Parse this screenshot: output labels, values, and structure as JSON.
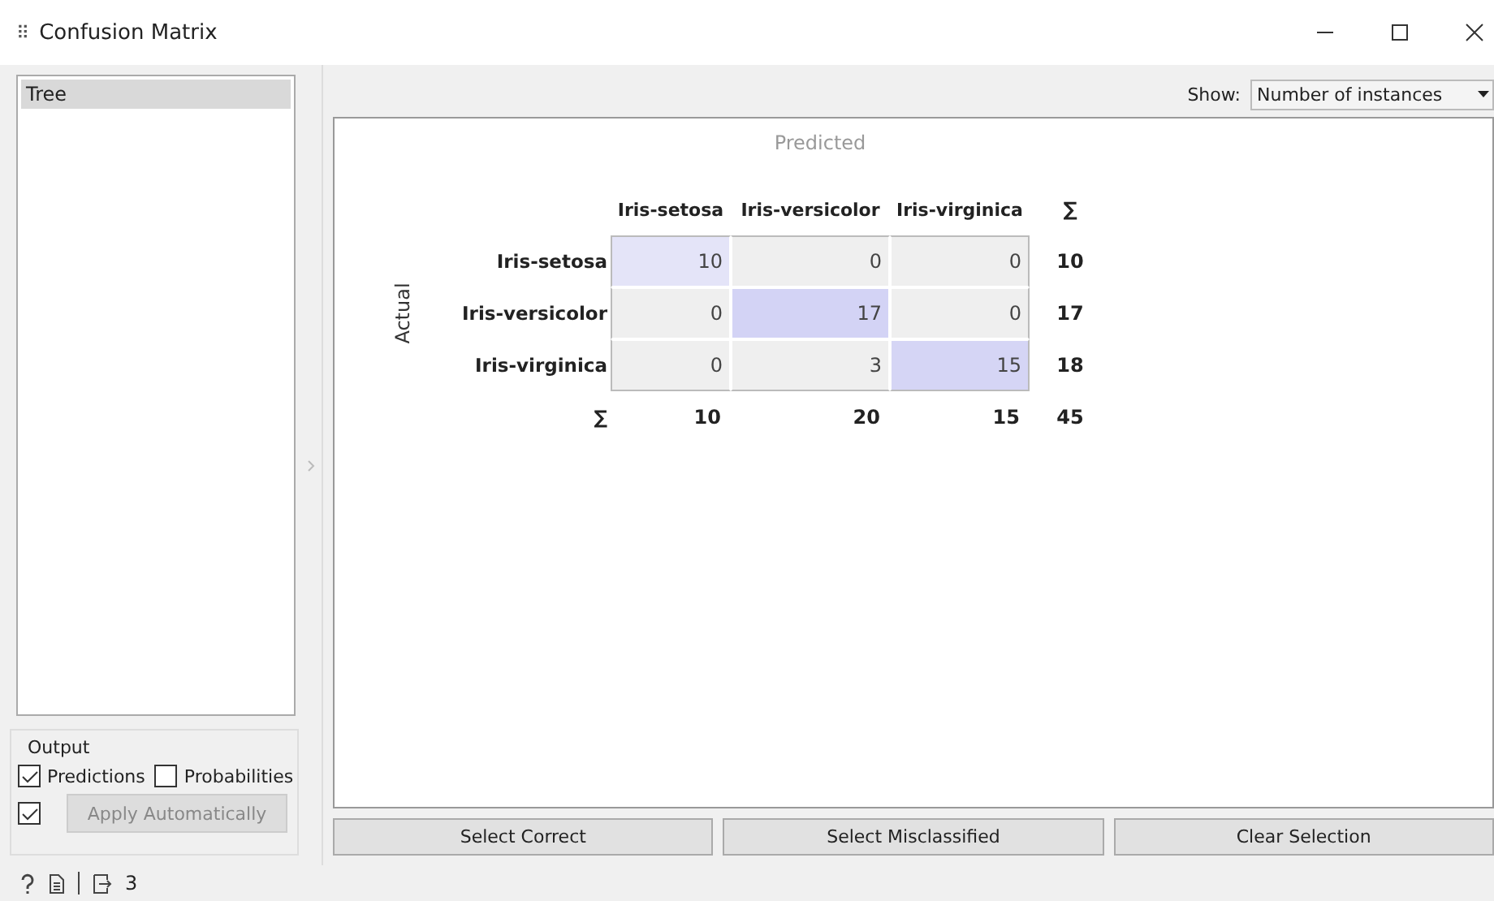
{
  "window": {
    "title": "Confusion Matrix",
    "icon": "⠿"
  },
  "learners": [
    {
      "label": "Tree",
      "selected": true
    }
  ],
  "output": {
    "title": "Output",
    "options": [
      {
        "label": "Predictions",
        "checked": true
      },
      {
        "label": "Probabilities",
        "checked": false
      }
    ],
    "auto_apply": {
      "checked": true,
      "label": "Apply Automatically",
      "disabled": true
    }
  },
  "show": {
    "label": "Show:",
    "value": "Number of instances"
  },
  "matrix": {
    "predicted_label": "Predicted",
    "actual_label": "Actual",
    "columns": [
      "Iris-setosa",
      "Iris-versicolor",
      "Iris-virginica"
    ],
    "sum_symbol": "∑",
    "rows": [
      {
        "label": "Iris-setosa",
        "cells": [
          {
            "value": "10",
            "color": "#e4e4f8"
          },
          {
            "value": "0",
            "color": "#efefef"
          },
          {
            "value": "0",
            "color": "#efefef"
          }
        ],
        "sum": "10"
      },
      {
        "label": "Iris-versicolor",
        "cells": [
          {
            "value": "0",
            "color": "#efefef"
          },
          {
            "value": "17",
            "color": "#d3d3f5"
          },
          {
            "value": "0",
            "color": "#efefef"
          }
        ],
        "sum": "17"
      },
      {
        "label": "Iris-virginica",
        "cells": [
          {
            "value": "0",
            "color": "#efefef"
          },
          {
            "value": "3",
            "color": "#efefef"
          },
          {
            "value": "15",
            "color": "#d5d5f5"
          }
        ],
        "sum": "18"
      }
    ],
    "column_sums": [
      "10",
      "20",
      "15"
    ],
    "total": "45"
  },
  "buttons": [
    "Select Correct",
    "Select Misclassified",
    "Clear Selection"
  ],
  "status_bar": {
    "output_count": "3"
  }
}
